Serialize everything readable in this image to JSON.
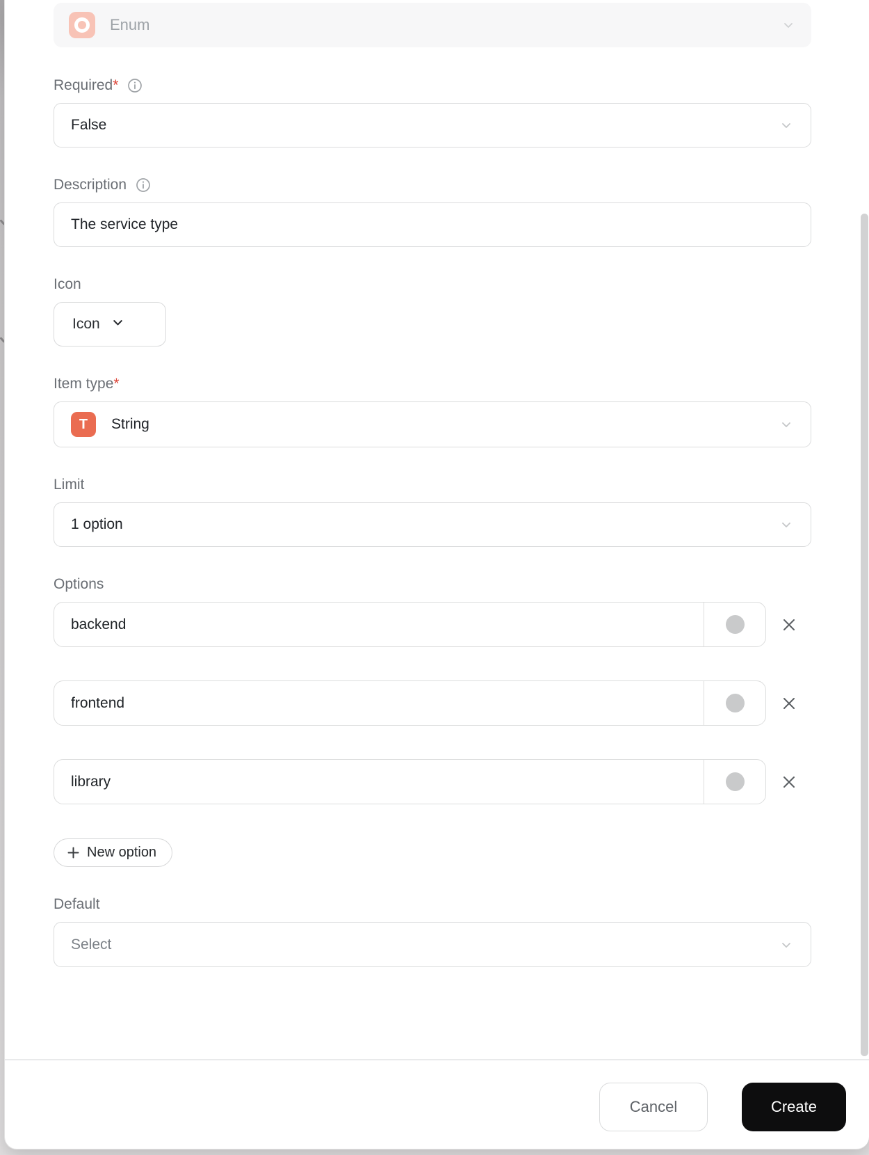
{
  "type_selector": {
    "value": "Enum"
  },
  "required_field": {
    "label": "Required",
    "mark": "*",
    "value": "False"
  },
  "description_field": {
    "label": "Description",
    "value": "The service type"
  },
  "icon_field": {
    "label": "Icon",
    "button_label": "Icon"
  },
  "item_type_field": {
    "label": "Item type",
    "mark": "*",
    "value": "String",
    "type_badge": "T"
  },
  "limit_field": {
    "label": "Limit",
    "value": "1 option"
  },
  "options_field": {
    "label": "Options",
    "items": [
      {
        "value": "backend"
      },
      {
        "value": "frontend"
      },
      {
        "value": "library"
      }
    ],
    "new_option_label": "New option"
  },
  "default_field": {
    "label": "Default",
    "placeholder": "Select"
  },
  "footer": {
    "cancel_label": "Cancel",
    "create_label": "Create"
  },
  "colors": {
    "enum_badge_bg": "#f8c3b6",
    "string_badge_bg": "#ea6c51",
    "required_asterisk": "#dc4437",
    "swatch_gray": "#c9cacb",
    "create_button_bg": "#0d0d0e",
    "scrollbar": "#d2d2d3"
  }
}
